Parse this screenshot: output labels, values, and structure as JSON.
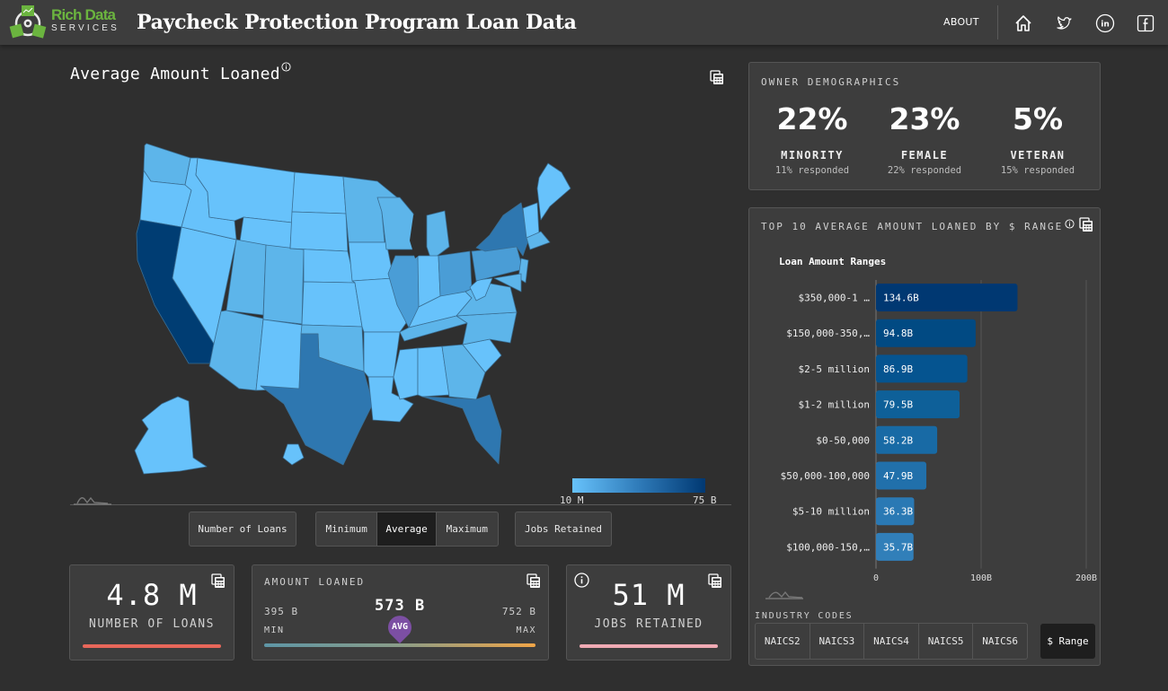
{
  "header": {
    "brand_top": "Rich Data",
    "brand_bottom": "SERVICES",
    "title": "Paycheck Protection Program Loan Data",
    "about_label": "ABOUT",
    "icons": [
      "home-icon",
      "twitter-icon",
      "linkedin-icon",
      "facebook-icon"
    ]
  },
  "map_panel": {
    "title": "Average Amount Loaned",
    "legend": {
      "min_label": "10 M",
      "max_label": "75 B",
      "colors": [
        "#67c2fb",
        "#2f7bb9",
        "#003872"
      ]
    },
    "state_colors": {
      "lightest": "#67c2fb",
      "light": "#5db5ea",
      "mid": "#4a9dd6",
      "dark": "#2e77b0",
      "darkest": "#003d73"
    },
    "highlighted_states": [
      {
        "name": "California",
        "shade": "darkest"
      },
      {
        "name": "Texas",
        "shade": "dark"
      },
      {
        "name": "Florida",
        "shade": "dark"
      },
      {
        "name": "New York",
        "shade": "dark"
      },
      {
        "name": "Illinois",
        "shade": "mid"
      },
      {
        "name": "Pennsylvania",
        "shade": "mid"
      },
      {
        "name": "Ohio",
        "shade": "mid"
      }
    ],
    "metric_buttons": {
      "number_of_loans": "Number of Loans",
      "minimum": "Minimum",
      "average": "Average",
      "maximum": "Maximum",
      "jobs_retained": "Jobs Retained",
      "active": "Average"
    }
  },
  "stats": {
    "loans": {
      "value": "4.8 M",
      "label": "NUMBER OF LOANS",
      "bar_color": "#e8675a"
    },
    "amount": {
      "title": "AMOUNT LOANED",
      "min_value": "395 B",
      "avg_value": "573 B",
      "max_value": "752 B",
      "min_label": "MIN",
      "avg_label": "AVG",
      "max_label": "MAX",
      "avg_position_fraction": 0.5
    },
    "jobs": {
      "value": "51 M",
      "label": "JOBS RETAINED",
      "bar_color": "#f0aab4"
    }
  },
  "demographics": {
    "title": "OWNER DEMOGRAPHICS",
    "items": [
      {
        "pct": "22%",
        "label": "MINORITY",
        "responded": "11% responded"
      },
      {
        "pct": "23%",
        "label": "FEMALE",
        "responded": "22% responded"
      },
      {
        "pct": "5%",
        "label": "VETERAN",
        "responded": "15% responded"
      }
    ]
  },
  "top10": {
    "title": "TOP 10 AVERAGE AMOUNT LOANED BY $ RANGE",
    "industry_codes_label": "INDUSTRY CODES",
    "naics_buttons": [
      "NAICS2",
      "NAICS3",
      "NAICS4",
      "NAICS5",
      "NAICS6"
    ],
    "range_button": "$ Range"
  },
  "chart_data": {
    "type": "bar",
    "orientation": "horizontal",
    "title": "Loan Amount Ranges",
    "xlabel": "",
    "ylabel": "",
    "categories": [
      "$350,000-1 …",
      "$150,000-350,…",
      "$2-5 million",
      "$1-2 million",
      "$0-50,000",
      "$50,000-100,000",
      "$5-10 million",
      "$100,000-150,…"
    ],
    "values": [
      134.6,
      94.8,
      86.9,
      79.5,
      58.2,
      47.9,
      36.3,
      35.7
    ],
    "value_labels": [
      "134.6B",
      "94.8B",
      "86.9B",
      "79.5B",
      "58.2B",
      "47.9B",
      "36.3B",
      "35.7B"
    ],
    "bar_colors": [
      "#003872",
      "#014a83",
      "#055490",
      "#0e6099",
      "#186aa5",
      "#2170ab",
      "#2a79b4",
      "#317fb9"
    ],
    "xlim": [
      0,
      200
    ],
    "xticks": [
      0,
      100,
      200
    ],
    "xtick_labels": [
      "0",
      "100B",
      "200B"
    ],
    "grid": true,
    "unit": "B"
  }
}
